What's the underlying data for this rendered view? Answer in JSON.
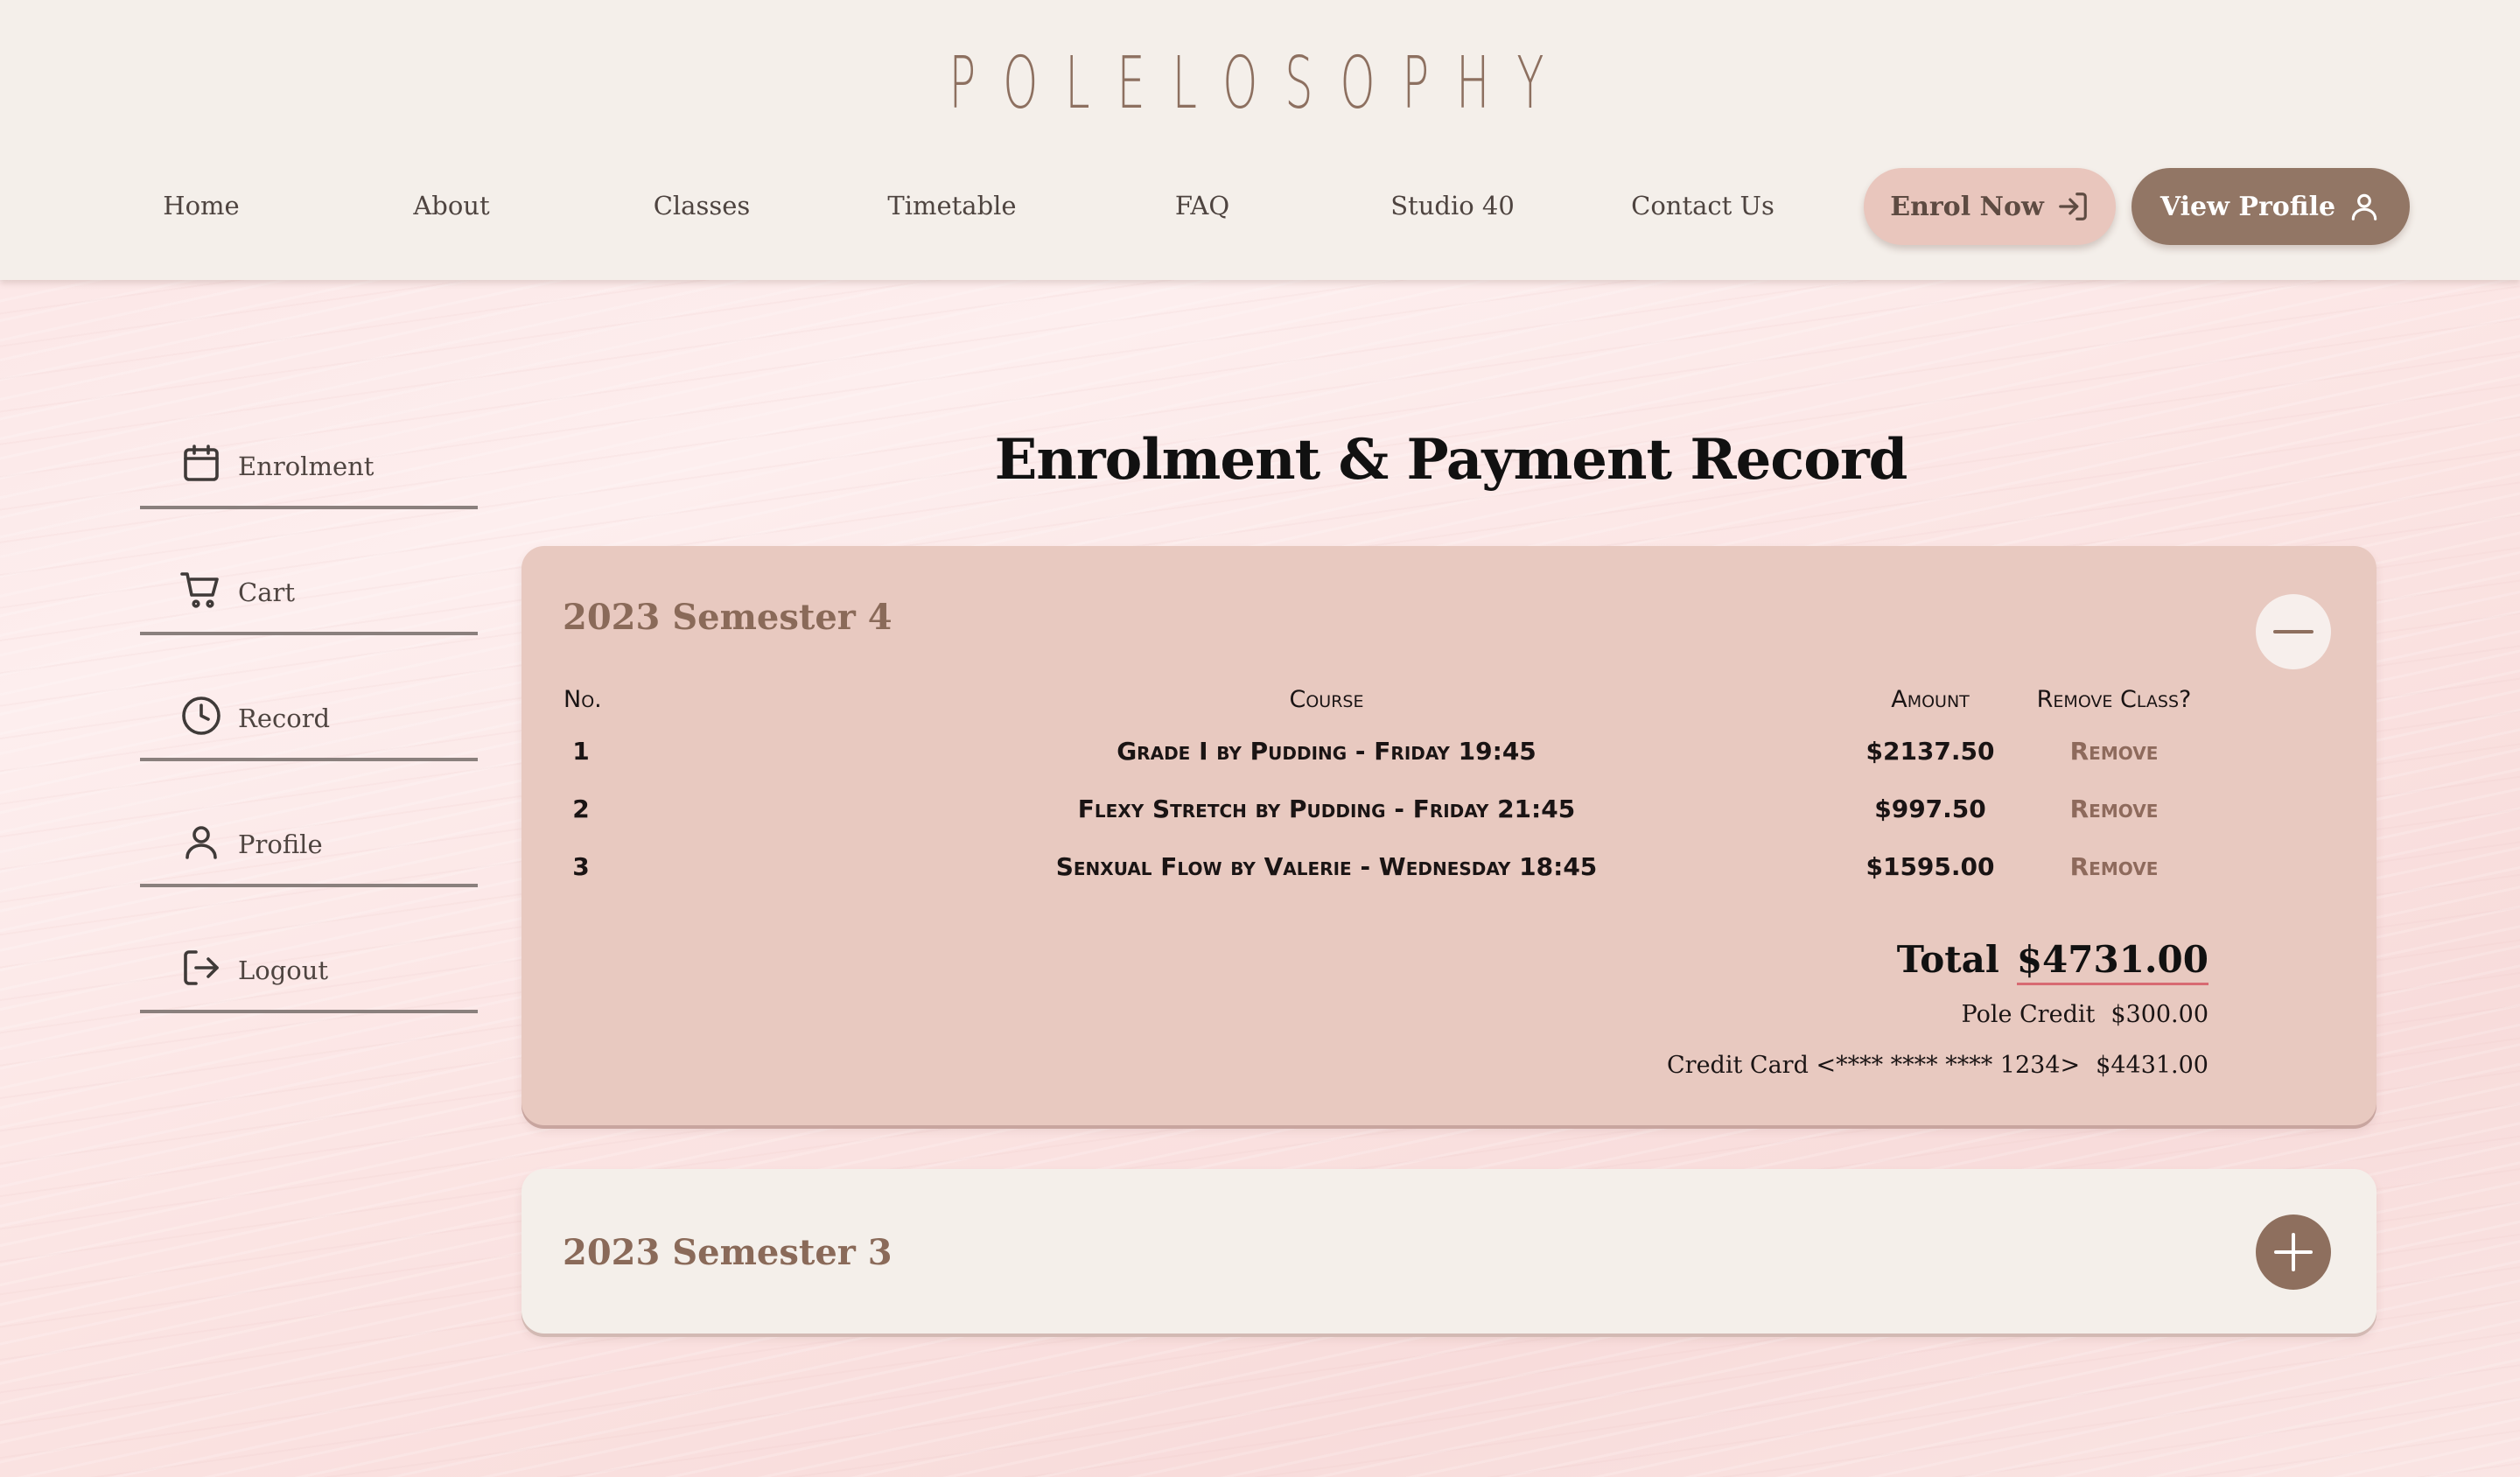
{
  "brand": "POLELOSOPHY",
  "nav": {
    "links": [
      "Home",
      "About",
      "Classes",
      "Timetable",
      "FAQ",
      "Studio 40",
      "Contact Us"
    ],
    "enrol_label": "Enrol Now",
    "profile_label": "View Profile"
  },
  "sidebar": {
    "items": [
      {
        "label": "Enrolment",
        "icon": "calendar-icon"
      },
      {
        "label": "Cart",
        "icon": "cart-icon"
      },
      {
        "label": "Record",
        "icon": "clock-icon"
      },
      {
        "label": "Profile",
        "icon": "user-icon"
      },
      {
        "label": "Logout",
        "icon": "logout-icon"
      }
    ]
  },
  "main": {
    "title": "Enrolment & Payment Record",
    "semesters": [
      {
        "title": "2023 Semester 4",
        "expanded": true,
        "columns": {
          "no": "No.",
          "course": "Course",
          "amount": "Amount",
          "remove": "Remove Class?"
        },
        "rows": [
          {
            "no": "1",
            "course": "Grade I by Pudding - Friday 19:45",
            "amount": "$2137.50",
            "action": "Remove"
          },
          {
            "no": "2",
            "course": "Flexy Stretch by Pudding - Friday 21:45",
            "amount": "$997.50",
            "action": "Remove"
          },
          {
            "no": "3",
            "course": "Senxual Flow by Valerie - Wednesday 18:45",
            "amount": "$1595.00",
            "action": "Remove"
          }
        ],
        "total_label": "Total",
        "total_value": "$4731.00",
        "payments": [
          {
            "label": "Pole Credit",
            "value": "$300.00"
          },
          {
            "label": "Credit Card <**** **** **** 1234>",
            "value": "$4431.00"
          }
        ]
      },
      {
        "title": "2023 Semester 3",
        "expanded": false
      }
    ]
  },
  "colors": {
    "header_bg": "#f4efea",
    "brand": "#8d7060",
    "accent_brown": "#927665",
    "accent_pink": "#e9c6bd",
    "panel_open": "#e8c9c0",
    "panel_closed": "#f4efea",
    "total_underline": "#d86a72"
  }
}
